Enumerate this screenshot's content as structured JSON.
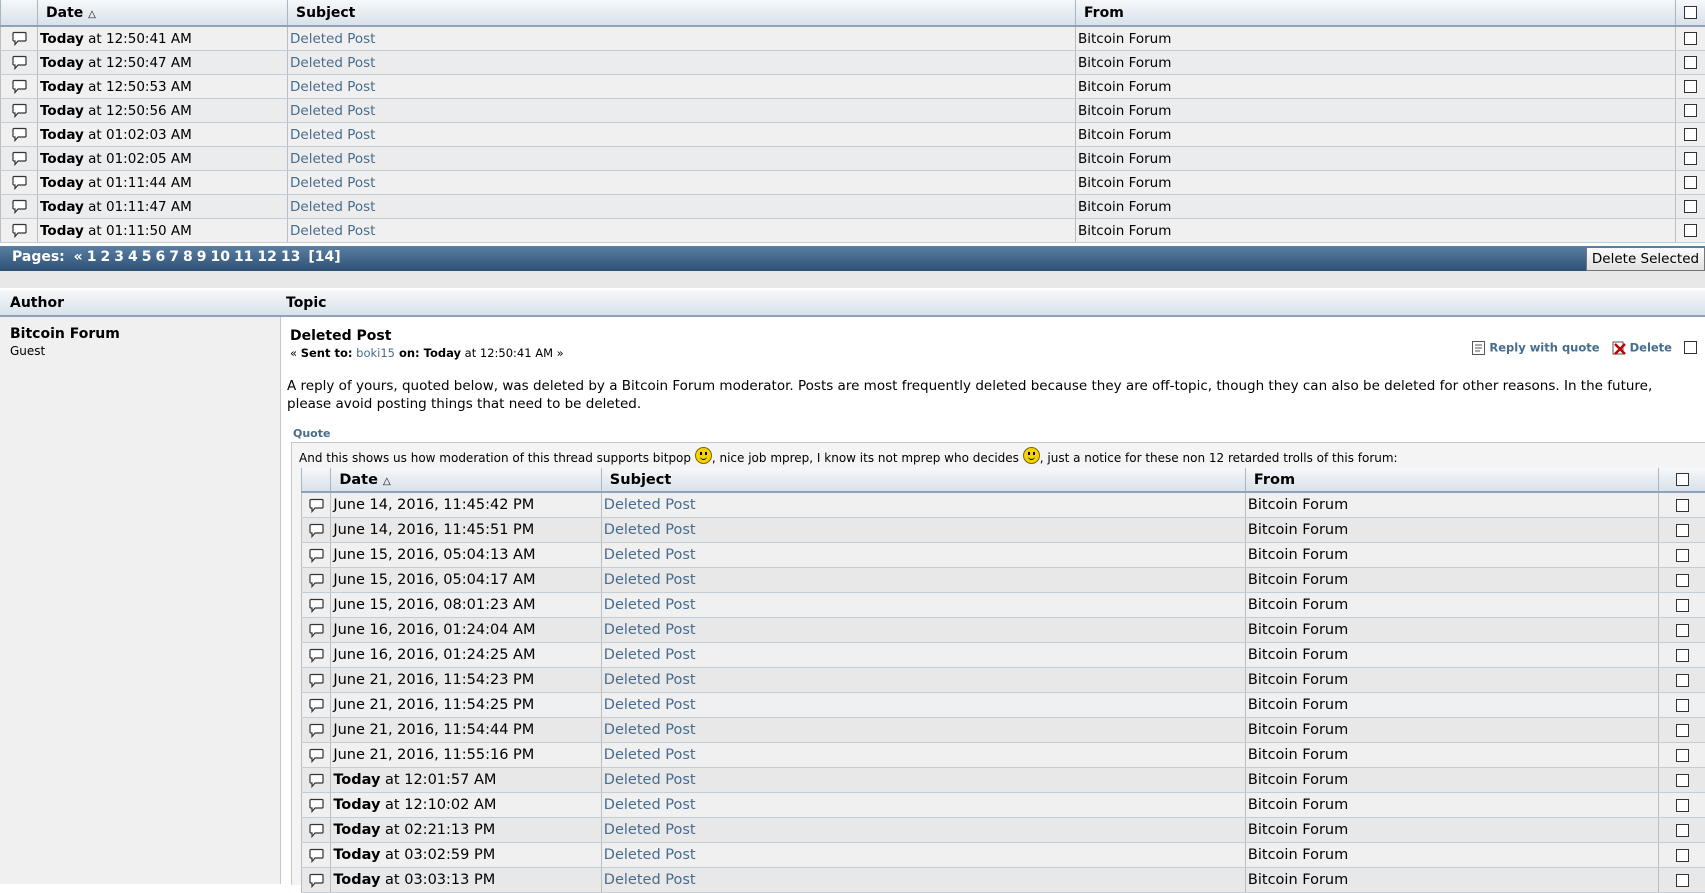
{
  "top_table": {
    "headers": {
      "date": "Date",
      "subject": "Subject",
      "from": "From"
    },
    "sort_icon": "sort-ascending-icon",
    "rows": [
      {
        "day": "Today",
        "time": " at 12:50:41 AM",
        "subject": "Deleted Post",
        "from": "Bitcoin Forum"
      },
      {
        "day": "Today",
        "time": " at 12:50:47 AM",
        "subject": "Deleted Post",
        "from": "Bitcoin Forum"
      },
      {
        "day": "Today",
        "time": " at 12:50:53 AM",
        "subject": "Deleted Post",
        "from": "Bitcoin Forum"
      },
      {
        "day": "Today",
        "time": " at 12:50:56 AM",
        "subject": "Deleted Post",
        "from": "Bitcoin Forum"
      },
      {
        "day": "Today",
        "time": " at 01:02:03 AM",
        "subject": "Deleted Post",
        "from": "Bitcoin Forum"
      },
      {
        "day": "Today",
        "time": " at 01:02:05 AM",
        "subject": "Deleted Post",
        "from": "Bitcoin Forum"
      },
      {
        "day": "Today",
        "time": " at 01:11:44 AM",
        "subject": "Deleted Post",
        "from": "Bitcoin Forum"
      },
      {
        "day": "Today",
        "time": " at 01:11:47 AM",
        "subject": "Deleted Post",
        "from": "Bitcoin Forum"
      },
      {
        "day": "Today",
        "time": " at 01:11:50 AM",
        "subject": "Deleted Post",
        "from": "Bitcoin Forum"
      }
    ]
  },
  "pagination": {
    "label": "Pages:",
    "prev": "«",
    "pages": [
      "1",
      "2",
      "3",
      "4",
      "5",
      "6",
      "7",
      "8",
      "9",
      "10",
      "11",
      "12",
      "13"
    ],
    "current": "[14]"
  },
  "delete_selected_label": "Delete Selected",
  "pm_header": {
    "author": "Author",
    "topic": "Topic"
  },
  "author": {
    "name": "Bitcoin Forum",
    "role": "Guest"
  },
  "post": {
    "title": "Deleted Post",
    "meta_prefix": "« ",
    "sent_to_label": "Sent to:",
    "recipient": "boki15",
    "on_label": " on: ",
    "day": "Today",
    "time": " at 12:50:41 AM »",
    "reply_with_quote": "Reply with quote",
    "delete": "Delete",
    "body": "A reply of yours, quoted below, was deleted by a Bitcoin Forum moderator. Posts are most frequently deleted because they are off-topic, though they can also be deleted for other reasons. In the future, please avoid posting things that need to be deleted."
  },
  "quote": {
    "label": "Quote",
    "text_part1": "And this shows us how moderation of this thread supports bitpop ",
    "text_part2": ", nice job mprep, I know its not mprep who decides ",
    "text_part3": ", just a notice for these non 12 retarded trolls of this forum:"
  },
  "quote_table": {
    "headers": {
      "date": "Date",
      "subject": "Subject",
      "from": "From"
    },
    "rows": [
      {
        "day": "",
        "time": "June 14, 2016, 11:45:42 PM",
        "subject": "Deleted Post",
        "from": "Bitcoin Forum"
      },
      {
        "day": "",
        "time": "June 14, 2016, 11:45:51 PM",
        "subject": "Deleted Post",
        "from": "Bitcoin Forum"
      },
      {
        "day": "",
        "time": "June 15, 2016, 05:04:13 AM",
        "subject": "Deleted Post",
        "from": "Bitcoin Forum"
      },
      {
        "day": "",
        "time": "June 15, 2016, 05:04:17 AM",
        "subject": "Deleted Post",
        "from": "Bitcoin Forum"
      },
      {
        "day": "",
        "time": "June 15, 2016, 08:01:23 AM",
        "subject": "Deleted Post",
        "from": "Bitcoin Forum"
      },
      {
        "day": "",
        "time": "June 16, 2016, 01:24:04 AM",
        "subject": "Deleted Post",
        "from": "Bitcoin Forum"
      },
      {
        "day": "",
        "time": "June 16, 2016, 01:24:25 AM",
        "subject": "Deleted Post",
        "from": "Bitcoin Forum"
      },
      {
        "day": "",
        "time": "June 21, 2016, 11:54:23 PM",
        "subject": "Deleted Post",
        "from": "Bitcoin Forum"
      },
      {
        "day": "",
        "time": "June 21, 2016, 11:54:25 PM",
        "subject": "Deleted Post",
        "from": "Bitcoin Forum"
      },
      {
        "day": "",
        "time": "June 21, 2016, 11:54:44 PM",
        "subject": "Deleted Post",
        "from": "Bitcoin Forum"
      },
      {
        "day": "",
        "time": "June 21, 2016, 11:55:16 PM",
        "subject": "Deleted Post",
        "from": "Bitcoin Forum"
      },
      {
        "day": "Today",
        "time": " at 12:01:57 AM",
        "subject": "Deleted Post",
        "from": "Bitcoin Forum"
      },
      {
        "day": "Today",
        "time": " at 12:10:02 AM",
        "subject": "Deleted Post",
        "from": "Bitcoin Forum"
      },
      {
        "day": "Today",
        "time": " at 02:21:13 PM",
        "subject": "Deleted Post",
        "from": "Bitcoin Forum"
      },
      {
        "day": "Today",
        "time": " at 03:02:59 PM",
        "subject": "Deleted Post",
        "from": "Bitcoin Forum"
      },
      {
        "day": "Today",
        "time": " at 03:03:13 PM",
        "subject": "Deleted Post",
        "from": "Bitcoin Forum"
      }
    ]
  },
  "colors": {
    "link": "#476c8e",
    "pagebar": "#2d5175",
    "header_border": "#8fa3b8"
  }
}
